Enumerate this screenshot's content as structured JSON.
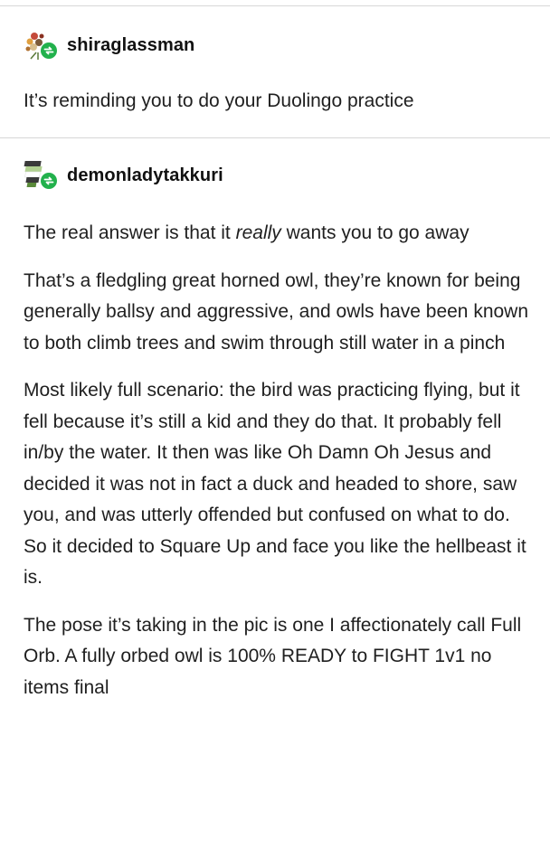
{
  "posts": [
    {
      "username": "shiraglassman",
      "avatar_icon": "flower-bouquet-avatar-icon",
      "reblog_badge_icon": "reblog-badge-icon",
      "paragraphs": [
        "It’s reminding you to do your Duolingo practice"
      ]
    },
    {
      "username": "demonladytakkuri",
      "avatar_icon": "flag-stripes-avatar-icon",
      "reblog_badge_icon": "reblog-badge-icon",
      "para1_before": "The real answer is that it ",
      "para1_em": "really",
      "para1_after": " wants you to go away",
      "paragraphs": [
        "That’s a fledgling great horned owl, they’re known for being generally ballsy and aggressive, and owls have been known to both climb trees and swim through still water in a pinch",
        "Most likely full scenario: the bird was practicing flying, but it fell because it’s still a kid and they do that. It probably fell in/by the water. It then was like Oh Damn Oh Jesus and decided it was not in fact a duck and headed to shore, saw you, and was utterly offended but confused on what to do. So it decided to Square Up and face you like the hellbeast it is.",
        "The pose it’s taking in the pic is one I affectionately call Full Orb. A fully orbed owl is 100% READY to FIGHT 1v1 no items final"
      ]
    }
  ],
  "colors": {
    "reblog_badge": "#22b14c",
    "divider": "#d7d7d7",
    "text": "#1f1f1f"
  }
}
